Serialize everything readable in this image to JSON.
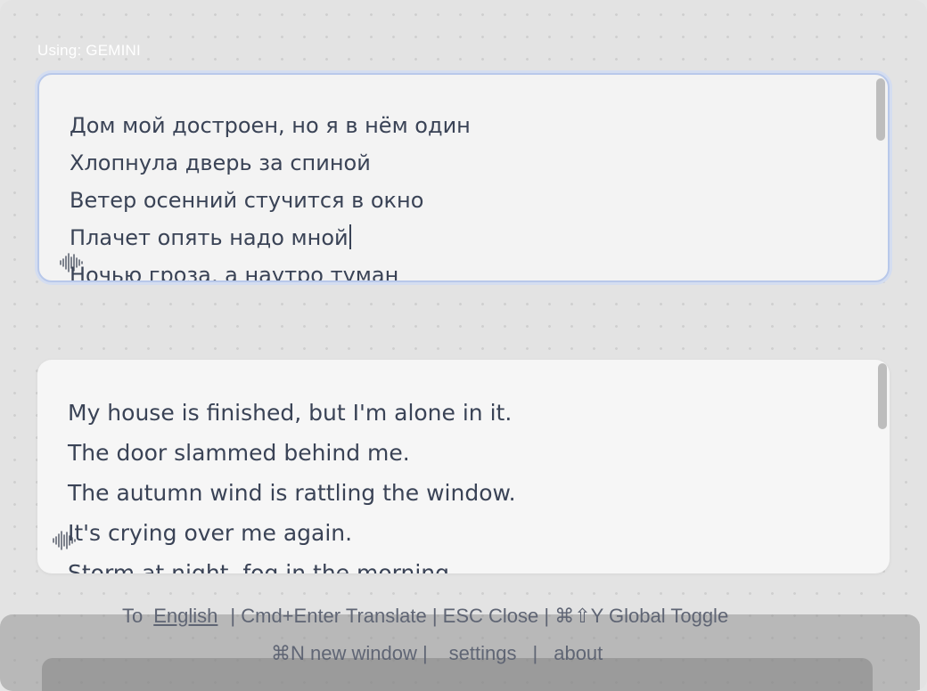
{
  "provider": {
    "label": "Using: GEMINI"
  },
  "source": {
    "lines": [
      "Дом мой достроен, но я в нём один",
      "Хлопнула дверь за спиной",
      "Ветер осенний стучится в окно",
      "Плачет опять надо мной",
      "Ночью гроза, а наутро туман"
    ],
    "mic_icon": "sound-wave-icon"
  },
  "result": {
    "lines": [
      "My house is finished, but I'm alone in it.",
      "The door slammed behind me.",
      "The autumn wind is rattling the window.",
      "It's crying over me again.",
      "Storm at night, fog in the morning"
    ],
    "mic_icon": "sound-wave-icon"
  },
  "footer": {
    "to_label": "To",
    "language": "English",
    "shortcut_translate": "| Cmd+Enter Translate",
    "shortcut_close": "| ESC Close",
    "shortcut_toggle": "| ⌘⇧Y Global Toggle",
    "new_window": "⌘N new window |",
    "settings": "settings",
    "separator": "|",
    "about": "about"
  },
  "colors": {
    "text": "#3a4356",
    "focus_ring": "#b8c8ea",
    "footer_text": "#5f6574"
  }
}
